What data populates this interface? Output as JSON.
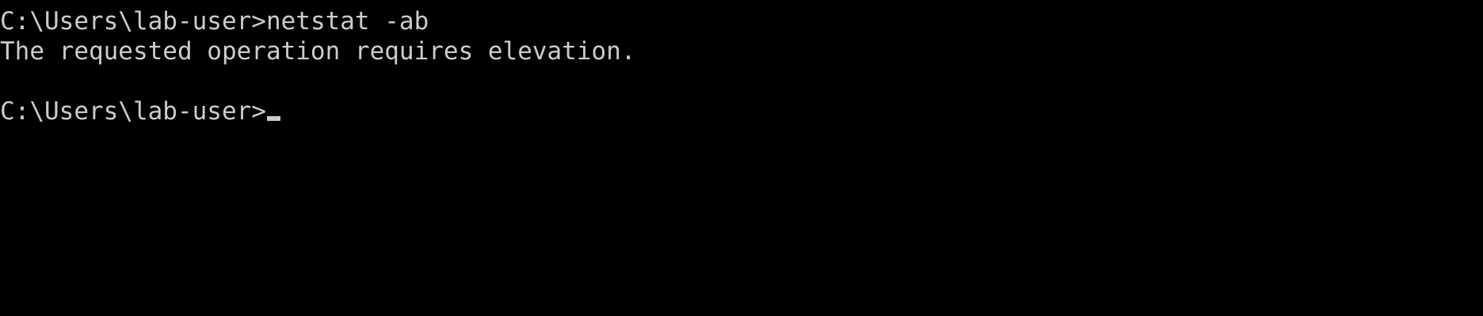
{
  "console": {
    "lines": [
      {
        "prompt": "C:\\Users\\lab-user>",
        "command": "netstat -ab"
      },
      {
        "output": "The requested operation requires elevation."
      },
      {
        "output": ""
      },
      {
        "prompt": "C:\\Users\\lab-user>",
        "command": ""
      }
    ]
  },
  "colors": {
    "background": "#000000",
    "text": "#cccccc"
  }
}
